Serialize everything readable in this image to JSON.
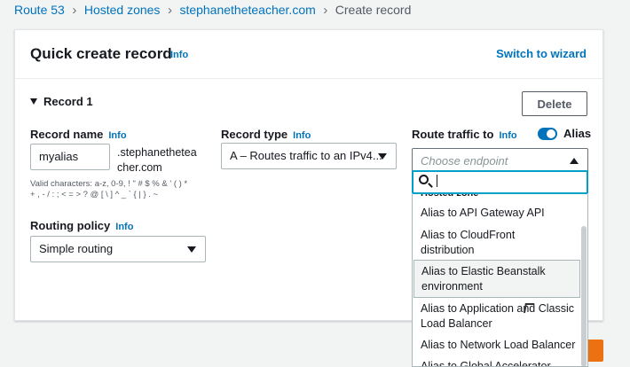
{
  "breadcrumb": [
    "Route 53",
    "Hosted zones",
    "stephanetheteacher.com",
    "Create record"
  ],
  "card": {
    "title": "Quick create record",
    "title_info": "Info",
    "switch_wizard": "Switch to wizard"
  },
  "record": {
    "header": "Record 1",
    "delete_label": "Delete",
    "name": {
      "label": "Record name",
      "info": "Info",
      "value": "myalias",
      "suffix_line1": ".stephanethetea",
      "suffix_line2": "cher.com",
      "help_line1": "Valid characters: a-z, 0-9, ! \" # $ % & ' ( ) *",
      "help_line2": "+ , - / : ; < = > ? @ [ \\ ] ^ _ ` { | } . ~"
    },
    "type": {
      "label": "Record type",
      "info": "Info",
      "value": "A – Routes traffic to an IPv4..."
    },
    "route": {
      "label": "Route traffic to",
      "info": "Info",
      "alias_label": "Alias",
      "alias_on": true,
      "placeholder": "Choose endpoint"
    },
    "routing_policy": {
      "label": "Routing policy",
      "info": "Info",
      "value": "Simple routing"
    }
  },
  "dropdown": {
    "search_value": "",
    "cut_header": "Hosted zone",
    "items": [
      {
        "line1": "Alias to API Gateway API",
        "line2": ""
      },
      {
        "line1": "Alias to CloudFront",
        "line2": "distribution"
      },
      {
        "line1": "Alias to Elastic Beanstalk",
        "line2": "environment"
      },
      {
        "line1": "Alias to Application and Classic",
        "line2": "Load Balancer"
      },
      {
        "line1": "Alias to Network Load Balancer",
        "line2": ""
      },
      {
        "line1": "Alias to Global Accelerator",
        "line2": ""
      }
    ]
  },
  "colors": {
    "link": "#0073bb",
    "focus": "#00a1c9",
    "primary": "#ec7211"
  }
}
